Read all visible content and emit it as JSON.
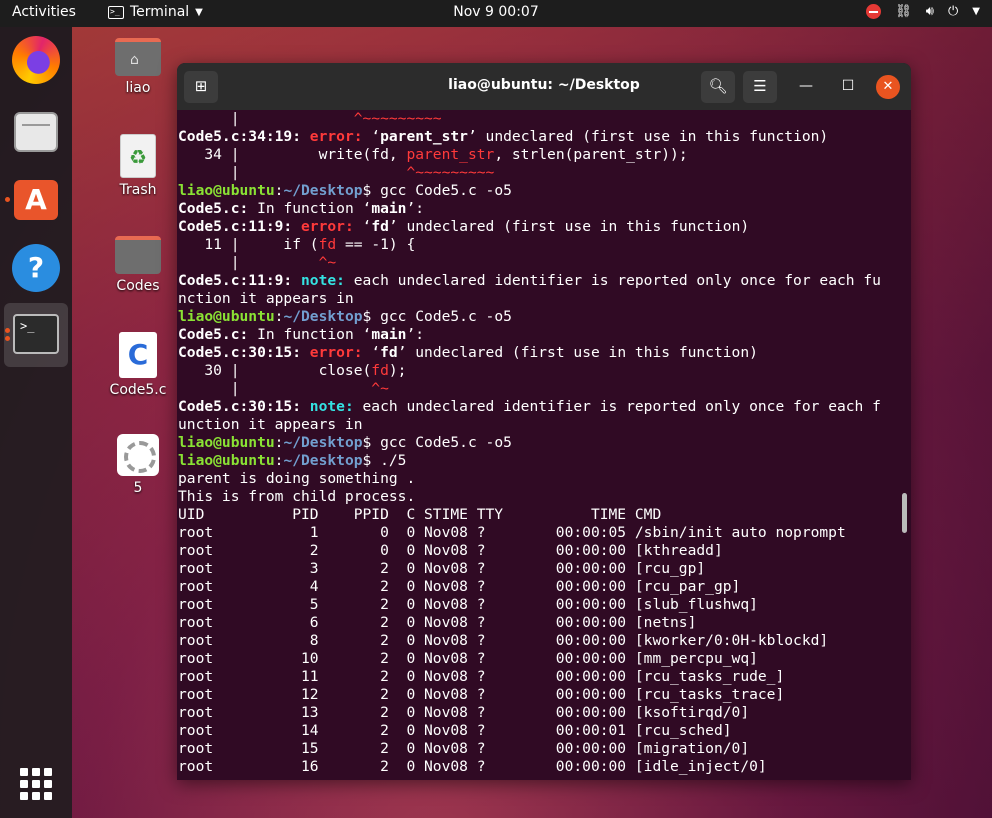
{
  "topbar": {
    "activities": "Activities",
    "app_name": "Terminal",
    "clock": "Nov 9  00:07"
  },
  "dock": {
    "items": [
      "Firefox",
      "Files",
      "Ubuntu Software",
      "Help",
      "Terminal"
    ]
  },
  "desktop": {
    "icons": [
      {
        "label": "liao"
      },
      {
        "label": "Trash"
      },
      {
        "label": "Codes"
      },
      {
        "label": "Code5.c"
      },
      {
        "label": "5"
      }
    ]
  },
  "window": {
    "title": "liao@ubuntu: ~/Desktop"
  },
  "terminal": {
    "prompt_user": "liao@ubuntu",
    "prompt_path": "~/Desktop",
    "lines": [
      "      |             ^~~~~~~~~~",
      "Code5.c:34:19: error: ‘parent_str’ undeclared (first use in this function)",
      "   34 |         write(fd, parent_str, strlen(parent_str));",
      "      |                   ^~~~~~~~~~",
      "liao@ubuntu:~/Desktop$ gcc Code5.c -o5",
      "Code5.c: In function ‘main’:",
      "Code5.c:11:9: error: ‘fd’ undeclared (first use in this function)",
      "   11 |     if (fd == -1) {",
      "      |         ^~",
      "Code5.c:11:9: note: each undeclared identifier is reported only once for each fu",
      "nction it appears in",
      "liao@ubuntu:~/Desktop$ gcc Code5.c -o5",
      "Code5.c: In function ‘main’:",
      "Code5.c:30:15: error: ‘fd’ undeclared (first use in this function)",
      "   30 |         close(fd);",
      "      |               ^~",
      "Code5.c:30:15: note: each undeclared identifier is reported only once for each f",
      "unction it appears in",
      "liao@ubuntu:~/Desktop$ gcc Code5.c -o5",
      "liao@ubuntu:~/Desktop$ ./5",
      "parent is doing something .",
      "This is from child process."
    ],
    "ps_header": "UID          PID    PPID  C STIME TTY          TIME CMD",
    "ps_rows": [
      "root           1       0  0 Nov08 ?        00:00:05 /sbin/init auto noprompt",
      "root           2       0  0 Nov08 ?        00:00:00 [kthreadd]",
      "root           3       2  0 Nov08 ?        00:00:00 [rcu_gp]",
      "root           4       2  0 Nov08 ?        00:00:00 [rcu_par_gp]",
      "root           5       2  0 Nov08 ?        00:00:00 [slub_flushwq]",
      "root           6       2  0 Nov08 ?        00:00:00 [netns]",
      "root           8       2  0 Nov08 ?        00:00:00 [kworker/0:0H-kblockd]",
      "root          10       2  0 Nov08 ?        00:00:00 [mm_percpu_wq]",
      "root          11       2  0 Nov08 ?        00:00:00 [rcu_tasks_rude_]",
      "root          12       2  0 Nov08 ?        00:00:00 [rcu_tasks_trace]",
      "root          13       2  0 Nov08 ?        00:00:00 [ksoftirqd/0]",
      "root          14       2  0 Nov08 ?        00:00:01 [rcu_sched]",
      "root          15       2  0 Nov08 ?        00:00:00 [migration/0]",
      "root          16       2  0 Nov08 ?        00:00:00 [idle_inject/0]"
    ]
  },
  "colors": {
    "terminal_bg": "#300a24",
    "prompt_user": "#8ae234",
    "prompt_path": "#729fcf",
    "error": "#ff3a3a",
    "note": "#34e2e2",
    "accent": "#e95420"
  }
}
